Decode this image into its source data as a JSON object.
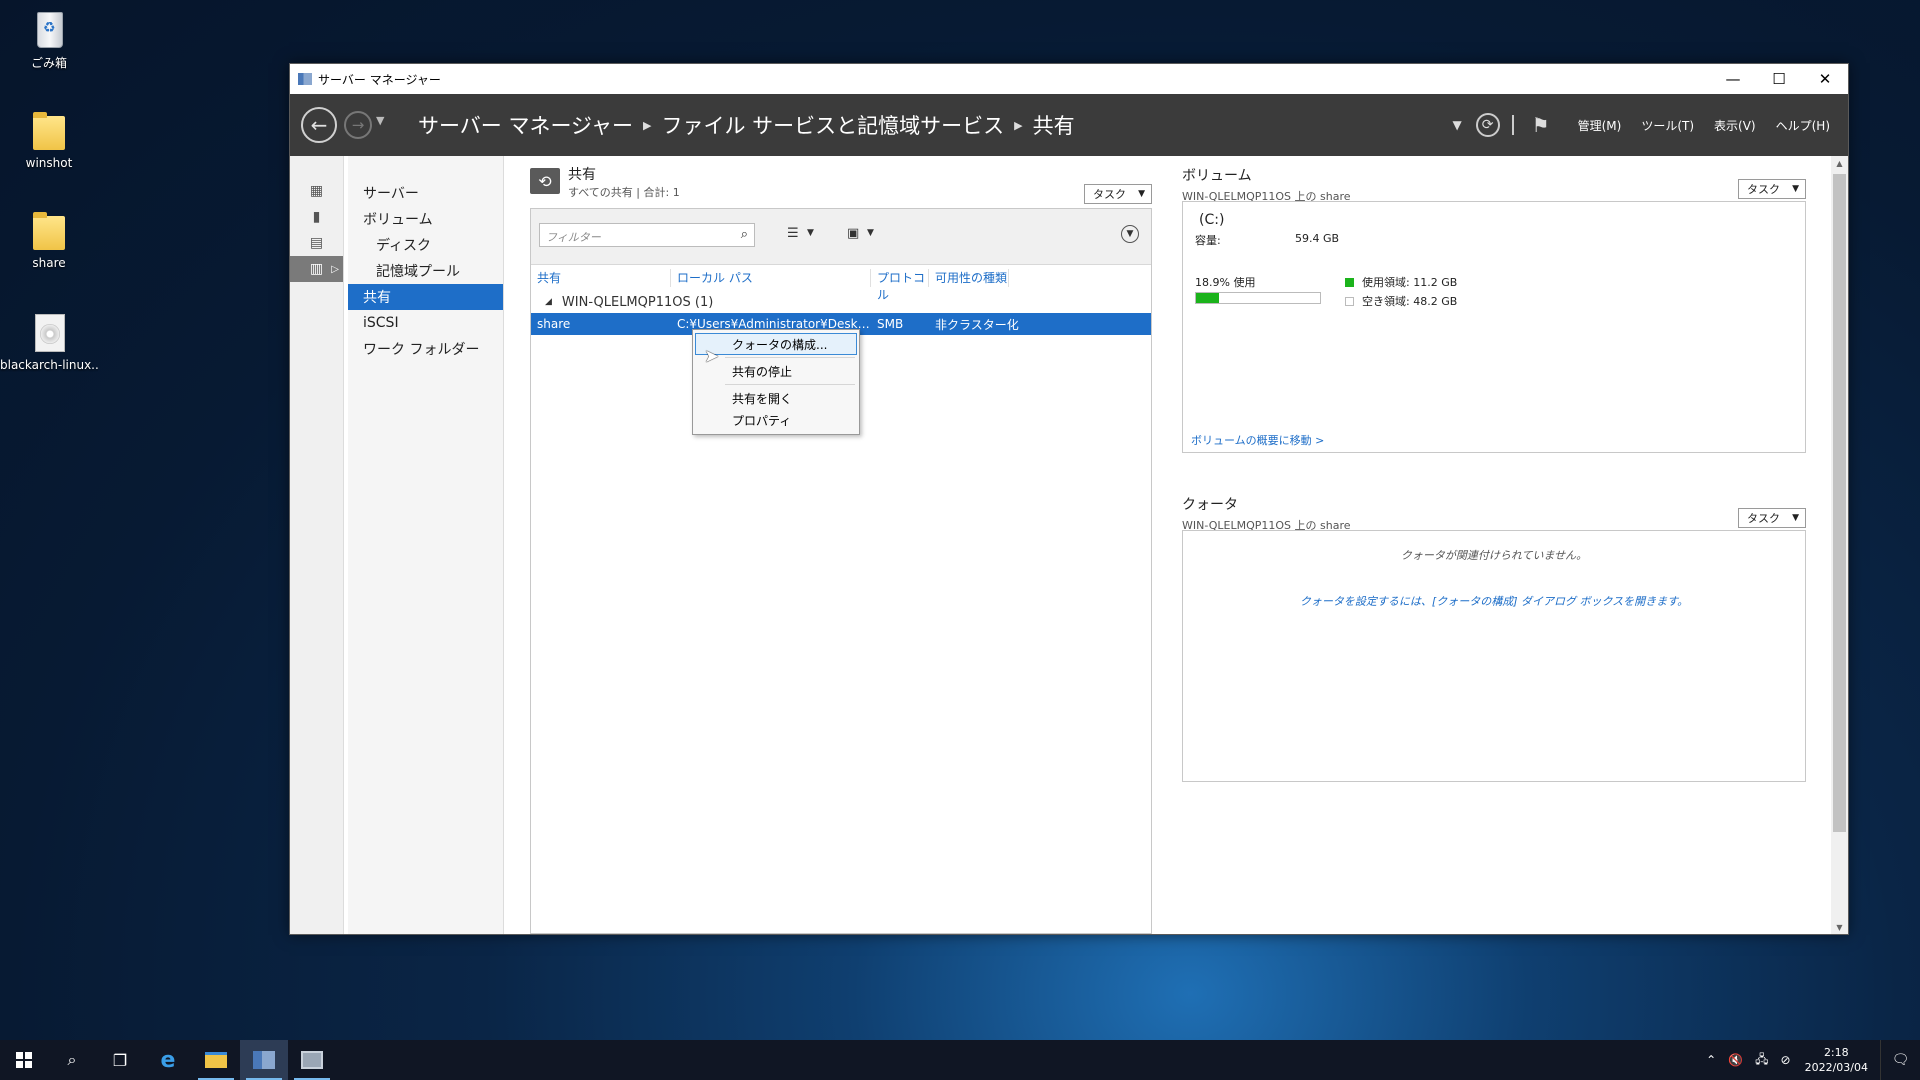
{
  "desktop": {
    "icons": [
      {
        "label": "ごみ箱",
        "icon": "recycle-bin-icon"
      },
      {
        "label": "winshot",
        "icon": "folder-icon"
      },
      {
        "label": "share",
        "icon": "folder-icon"
      },
      {
        "label": "blackarch-linux...",
        "icon": "disc-image-icon"
      }
    ]
  },
  "window": {
    "title": "サーバー マネージャー",
    "controls": {
      "minimize": "—",
      "maximize": "☐",
      "close": "✕"
    }
  },
  "header": {
    "breadcrumb": [
      "サーバー マネージャー",
      "ファイル サービスと記憶域サービス",
      "共有"
    ],
    "menu": [
      "管理(M)",
      "ツール(T)",
      "表示(V)",
      "ヘルプ(H)"
    ]
  },
  "subnav": {
    "items": [
      {
        "label": "サーバー",
        "indent": false,
        "active": false
      },
      {
        "label": "ボリューム",
        "indent": false,
        "active": false
      },
      {
        "label": "ディスク",
        "indent": true,
        "active": false
      },
      {
        "label": "記憶域プール",
        "indent": true,
        "active": false
      },
      {
        "label": "共有",
        "indent": false,
        "active": true
      },
      {
        "label": "iSCSI",
        "indent": false,
        "active": false
      },
      {
        "label": "ワーク フォルダー",
        "indent": false,
        "active": false
      }
    ]
  },
  "shares": {
    "title": "共有",
    "subtitle": "すべての共有 | 合計: 1",
    "task_label": "タスク",
    "filter_placeholder": "フィルター",
    "columns": [
      "共有",
      "ローカル パス",
      "プロトコル",
      "可用性の種類"
    ],
    "group": "WIN-QLELMQP11OS (1)",
    "rows": [
      {
        "share": "share",
        "path": "C:¥Users¥Administrator¥Desktop¥...",
        "protocol": "SMB",
        "availability": "非クラスター化"
      }
    ]
  },
  "context_menu": {
    "items": [
      "クォータの構成...",
      "共有の停止",
      "共有を開く",
      "プロパティ"
    ]
  },
  "volume": {
    "title": "ボリューム",
    "subtitle": "WIN-QLELMQP11OS 上の share",
    "task_label": "タスク",
    "drive": "(C:)",
    "capacity_label": "容量:",
    "capacity_value": "59.4 GB",
    "used_text": "18.9% 使用",
    "used_fraction": 0.189,
    "used_space": "使用領域: 11.2 GB",
    "free_space": "空き領域: 48.2 GB",
    "link": "ボリュームの概要に移動 >",
    "colors": {
      "used": "#1bb31b",
      "free": "#ffffff"
    }
  },
  "quota": {
    "title": "クォータ",
    "subtitle": "WIN-QLELMQP11OS 上の share",
    "task_label": "タスク",
    "message1": "クォータが関連付けられていません。",
    "message2": "クォータを設定するには、[クォータの構成] ダイアログ ボックスを開きます。"
  },
  "taskbar": {
    "time": "2:18",
    "date": "2022/03/04"
  }
}
